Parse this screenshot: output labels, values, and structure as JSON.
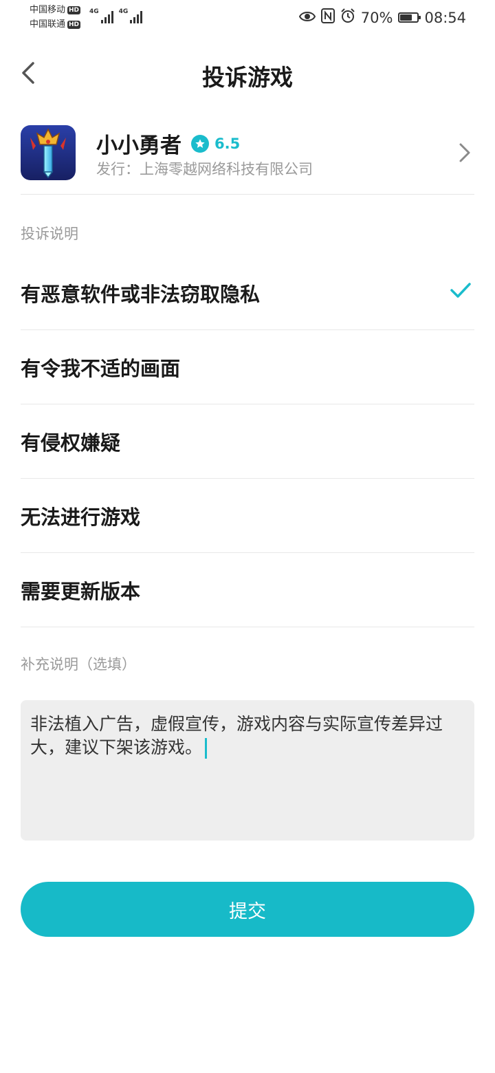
{
  "status_bar": {
    "carrier1": "中国移动",
    "carrier2": "中国联通",
    "hd_label": "HD",
    "network1": "4G",
    "network2": "4G",
    "battery_percent": "70%",
    "battery_level": 0.7,
    "time": "08:54"
  },
  "header": {
    "title": "投诉游戏"
  },
  "game": {
    "name": "小小勇者",
    "rating": "6.5",
    "publisher": "发行：上海零越网络科技有限公司"
  },
  "complaint": {
    "section_label": "投诉说明",
    "options": [
      {
        "label": "有恶意软件或非法窃取隐私",
        "selected": true
      },
      {
        "label": "有令我不适的画面",
        "selected": false
      },
      {
        "label": "有侵权嫌疑",
        "selected": false
      },
      {
        "label": "无法进行游戏",
        "selected": false
      },
      {
        "label": "需要更新版本",
        "selected": false
      }
    ]
  },
  "supplement": {
    "section_label": "补充说明（选填）",
    "value": "非法植入广告，虚假宣传，游戏内容与实际宣传差异过大，建议下架该游戏。"
  },
  "submit_label": "提交",
  "colors": {
    "accent": "#17bac8",
    "rating": "#1abccc",
    "muted_text": "#9a9a9a",
    "input_bg": "#eeeeee"
  }
}
